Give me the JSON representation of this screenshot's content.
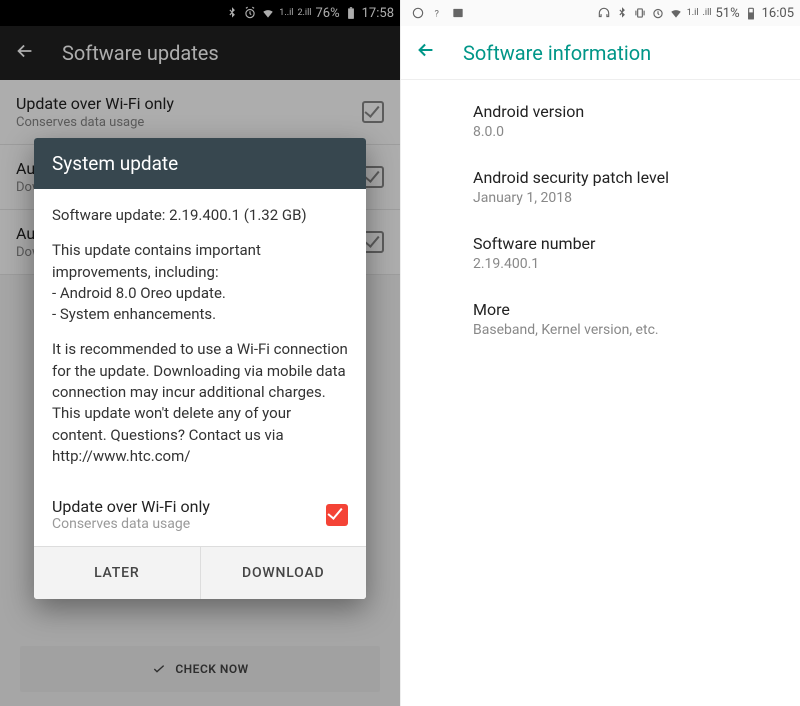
{
  "left": {
    "status": {
      "battery": "76%",
      "time": "17:58"
    },
    "header_title": "Software updates",
    "rows": [
      {
        "title": "Update over Wi-Fi only",
        "sub": "Conserves data usage"
      },
      {
        "title": "Aut",
        "sub": "Dow"
      },
      {
        "title": "Aut",
        "sub": "Dow"
      }
    ],
    "check_now": "CHECK NOW",
    "dialog": {
      "title": "System update",
      "line1": "Software update: 2.19.400.1 (1.32 GB)",
      "line2": "This update contains important improvements, including:\n- Android 8.0 Oreo update.\n- System enhancements.",
      "line3": "It is recommended to use a Wi-Fi connection for the update. Downloading via mobile data connection may incur additional charges.\nThis update won't delete any of your content. Questions? Contact us via http://www.htc.com/",
      "wifi_title": "Update over Wi-Fi only",
      "wifi_sub": "Conserves data usage",
      "btn_later": "LATER",
      "btn_download": "DOWNLOAD"
    }
  },
  "right": {
    "status": {
      "battery": "51%",
      "time": "16:05"
    },
    "header_title": "Software information",
    "items": [
      {
        "label": "Android version",
        "value": "8.0.0"
      },
      {
        "label": "Android security patch level",
        "value": "January 1, 2018"
      },
      {
        "label": "Software number",
        "value": "2.19.400.1"
      },
      {
        "label": "More",
        "value": "Baseband, Kernel version, etc."
      }
    ]
  }
}
